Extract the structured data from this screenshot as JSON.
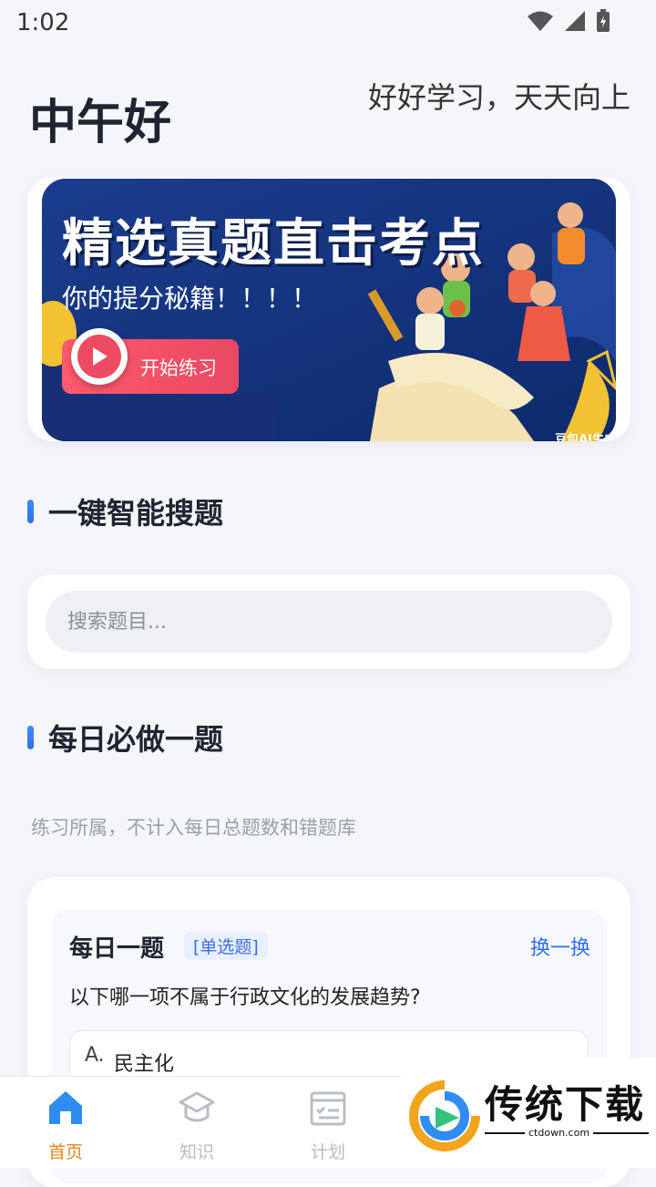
{
  "status_bar": {
    "time": "1:02"
  },
  "header": {
    "greeting": "中午好",
    "motto": "好好学习，天天向上"
  },
  "banner": {
    "title": "精选真题直击考点",
    "subtitle": "你的提分秘籍！！！！",
    "button_label": "开始练习",
    "watermark": "豆包AI生成"
  },
  "search_section": {
    "title": "一键智能搜题",
    "placeholder": "搜索题目..."
  },
  "daily_section": {
    "title": "每日必做一题",
    "hint": "练习所属，不计入每日总题数和错题库",
    "card": {
      "title": "每日一题",
      "type": "[单选题]",
      "swap_label": "换一换",
      "question": "以下哪一项不属于行政文化的发展趋势?",
      "options": [
        {
          "key": "A.",
          "text": "民主化"
        }
      ]
    }
  },
  "tabbar": {
    "tabs": [
      {
        "label": "首页",
        "icon": "home-icon",
        "active": true
      },
      {
        "label": "知识",
        "icon": "graduation-cap-icon",
        "active": false
      },
      {
        "label": "计划",
        "icon": "calendar-checklist-icon",
        "active": false
      }
    ]
  },
  "ad": {
    "brand": "传统下载",
    "url": "ctdown.com"
  },
  "colors": {
    "accent": "#2f6ef0",
    "active_tab": "#e08a1e",
    "banner_button": "#ee4a62"
  }
}
